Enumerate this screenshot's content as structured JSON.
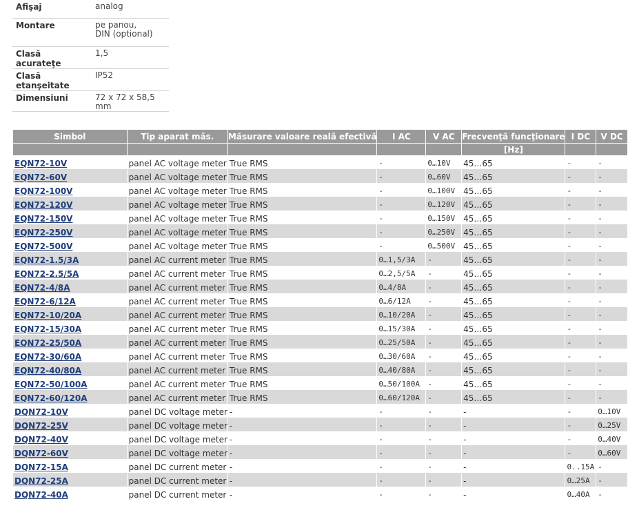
{
  "specs": [
    {
      "key": "Afişaj",
      "value": "analog"
    },
    {
      "key": "Montare",
      "value": "pe panou,\nDIN (optional)"
    },
    {
      "key": "Clasă acurateţe",
      "value": "1,5"
    },
    {
      "key": "Clasă etanşeitate",
      "value": "IP52"
    },
    {
      "key": "Dimensiuni",
      "value": "72 x 72 x 58,5 mm"
    }
  ],
  "table": {
    "headers": [
      "Simbol",
      "Tip aparat măs.",
      "Măsurare valoare reală efectivă",
      "I AC",
      "V AC",
      "Frecvenţă funcţionare",
      "I DC",
      "V DC"
    ],
    "subheader_freq": "[Hz]",
    "rows": [
      [
        "EQN72-10V",
        "panel AC voltage meter",
        "True RMS",
        "-",
        "0…10V",
        "45…65",
        "-",
        "-"
      ],
      [
        "EQN72-60V",
        "panel AC voltage meter",
        "True RMS",
        "-",
        "0…60V",
        "45…65",
        "-",
        "-"
      ],
      [
        "EQN72-100V",
        "panel AC voltage meter",
        "True RMS",
        "-",
        "0…100V",
        "45…65",
        "-",
        "-"
      ],
      [
        "EQN72-120V",
        "panel AC voltage meter",
        "True RMS",
        "-",
        "0…120V",
        "45…65",
        "-",
        "-"
      ],
      [
        "EQN72-150V",
        "panel AC voltage meter",
        "True RMS",
        "-",
        "0…150V",
        "45…65",
        "-",
        "-"
      ],
      [
        "EQN72-250V",
        "panel AC voltage meter",
        "True RMS",
        "-",
        "0…250V",
        "45…65",
        "-",
        "-"
      ],
      [
        "EQN72-500V",
        "panel AC voltage meter",
        "True RMS",
        "-",
        "0…500V",
        "45…65",
        "-",
        "-"
      ],
      [
        "EQN72-1.5/3A",
        "panel AC current meter",
        "True RMS",
        "0…1,5/3A",
        "-",
        "45…65",
        "-",
        "-"
      ],
      [
        "EQN72-2.5/5A",
        "panel AC current meter",
        "True RMS",
        "0…2,5/5A",
        "-",
        "45…65",
        "-",
        "-"
      ],
      [
        "EQN72-4/8A",
        "panel AC current meter",
        "True RMS",
        "0…4/8A",
        "-",
        "45…65",
        "-",
        "-"
      ],
      [
        "EQN72-6/12A",
        "panel AC current meter",
        "True RMS",
        "0…6/12A",
        "-",
        "45…65",
        "-",
        "-"
      ],
      [
        "EQN72-10/20A",
        "panel AC current meter",
        "True RMS",
        "0…10/20A",
        "-",
        "45…65",
        "-",
        "-"
      ],
      [
        "EQN72-15/30A",
        "panel AC current meter",
        "True RMS",
        "0…15/30A",
        "-",
        "45…65",
        "-",
        "-"
      ],
      [
        "EQN72-25/50A",
        "panel AC current meter",
        "True RMS",
        "0…25/50A",
        "-",
        "45…65",
        "-",
        "-"
      ],
      [
        "EQN72-30/60A",
        "panel AC current meter",
        "True RMS",
        "0…30/60A",
        "-",
        "45…65",
        "-",
        "-"
      ],
      [
        "EQN72-40/80A",
        "panel AC current meter",
        "True RMS",
        "0…40/80A",
        "-",
        "45…65",
        "-",
        "-"
      ],
      [
        "EQN72-50/100A",
        "panel AC current meter",
        "True RMS",
        "0…50/100A",
        "-",
        "45…65",
        "-",
        "-"
      ],
      [
        "EQN72-60/120A",
        "panel AC current meter",
        "True RMS",
        "0…60/120A",
        "-",
        "45…65",
        "-",
        "-"
      ],
      [
        "DQN72-10V",
        "panel DC voltage meter",
        "-",
        "-",
        "-",
        "-",
        "-",
        "0…10V"
      ],
      [
        "DQN72-25V",
        "panel DC voltage meter",
        "-",
        "-",
        "-",
        "-",
        "-",
        "0…25V"
      ],
      [
        "DQN72-40V",
        "panel DC voltage meter",
        "-",
        "-",
        "-",
        "-",
        "-",
        "0…40V"
      ],
      [
        "DQN72-60V",
        "panel DC voltage meter",
        "-",
        "-",
        "-",
        "-",
        "-",
        "0…60V"
      ],
      [
        "DQN72-15A",
        "panel DC current meter",
        "-",
        "-",
        "-",
        "-",
        "0..15A",
        "-"
      ],
      [
        "DQN72-25A",
        "panel DC current meter",
        "-",
        "-",
        "-",
        "-",
        "0…25A",
        "-"
      ],
      [
        "DQN72-40A",
        "panel DC current meter",
        "-",
        "-",
        "-",
        "-",
        "0…40A",
        "-"
      ]
    ]
  },
  "colors": {
    "header_bg": "#9a9a9a",
    "stripe": "#d9d9d9",
    "link": "#1f3d7a"
  }
}
